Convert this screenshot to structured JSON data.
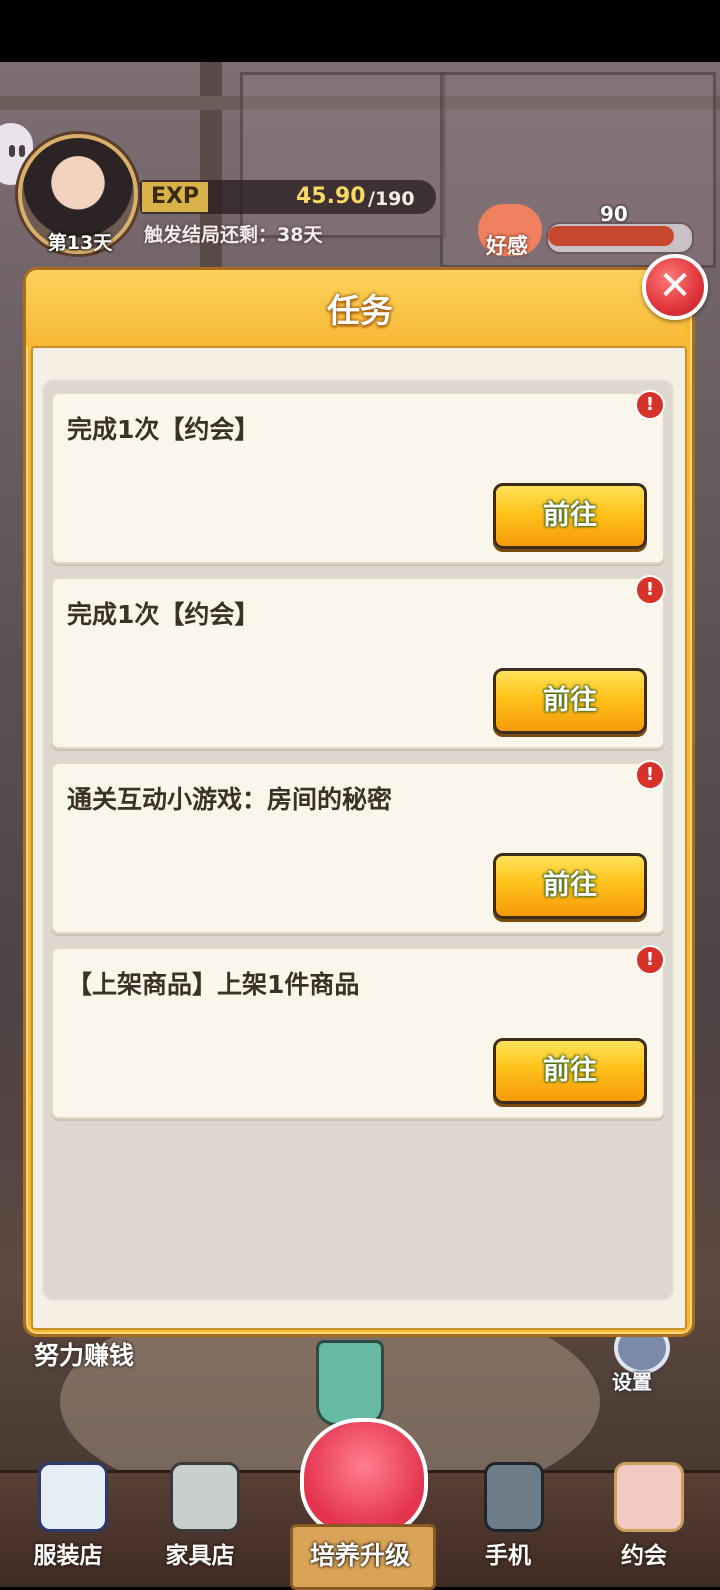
{
  "hud": {
    "day": "第13天",
    "exp_tag": "EXP",
    "exp_value": "45.90",
    "exp_max": "/190",
    "ending_text": "触发结局还剩：38天",
    "favor_label": "好感",
    "favor_value": "90",
    "favor_fraction": 0.9
  },
  "modal": {
    "title": "任务",
    "close_icon": "close-icon",
    "tasks": [
      {
        "text": "完成1次【约会】",
        "button": "前往",
        "alert": "!"
      },
      {
        "text": "完成1次【约会】",
        "button": "前往",
        "alert": "!"
      },
      {
        "text": "通关互动小游戏：房间的秘密",
        "button": "前往",
        "alert": "!"
      },
      {
        "text": "【上架商品】上架1件商品",
        "button": "前往",
        "alert": "!"
      }
    ]
  },
  "scene": {
    "earn_text": "努力赚钱",
    "settings_label": "设置"
  },
  "nav": {
    "items": [
      {
        "label": "服装店",
        "icon": "uniform-icon"
      },
      {
        "label": "家具店",
        "icon": "sofa-icon"
      },
      {
        "label": "培养升级",
        "icon": "cupid-heart-icon"
      },
      {
        "label": "手机",
        "icon": "phone-icon"
      },
      {
        "label": "约会",
        "icon": "bouquet-icon"
      }
    ]
  },
  "colors": {
    "modal_gold": "#f6b92f",
    "button_orange": "#ffc21a",
    "alert_red": "#d7322a",
    "close_red": "#e0343a"
  }
}
